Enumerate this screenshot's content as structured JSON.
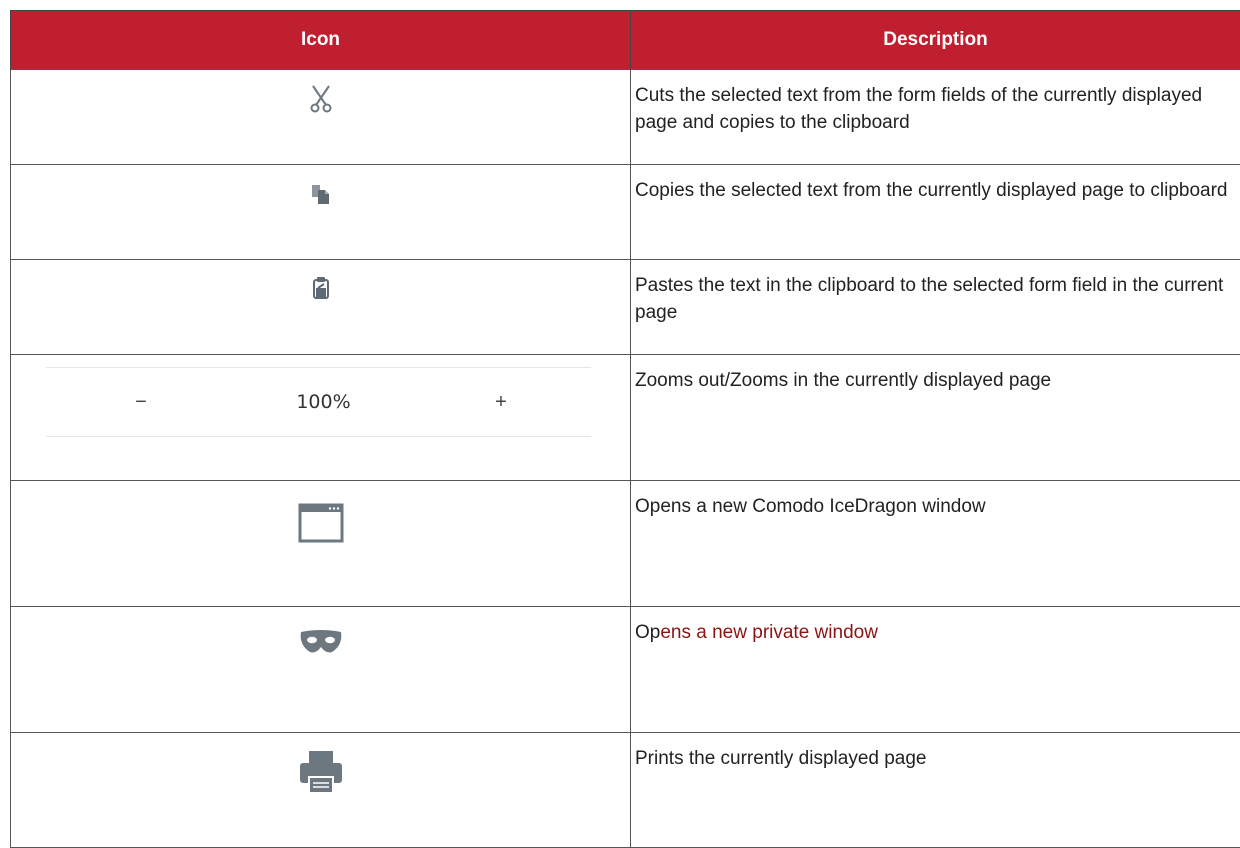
{
  "table": {
    "headers": {
      "icon": "Icon",
      "description": "Description"
    },
    "rows": [
      {
        "icon": "scissors-icon",
        "description": "Cuts the selected text from the form fields of the currently displayed page and copies to the clipboard"
      },
      {
        "icon": "copy-icon",
        "description": "Copies the selected text from the currently displayed page to clipboard"
      },
      {
        "icon": "paste-icon",
        "description": "Pastes the text in the clipboard to the selected form field in the current page"
      },
      {
        "icon": "zoom-control",
        "zoom": {
          "minus": "−",
          "level": "100%",
          "plus": "+"
        },
        "description": "Zooms out/Zooms in the currently displayed page"
      },
      {
        "icon": "new-window-icon",
        "description": "Opens a new Comodo IceDragon window"
      },
      {
        "icon": "private-mask-icon",
        "description_plain": "Op",
        "description_link": "ens a new private window"
      },
      {
        "icon": "printer-icon",
        "description": "Prints the currently displayed page"
      }
    ]
  },
  "colors": {
    "header_bg": "#c01f2f",
    "icon_gray": "#6d7780",
    "link_red": "#8b1515"
  }
}
